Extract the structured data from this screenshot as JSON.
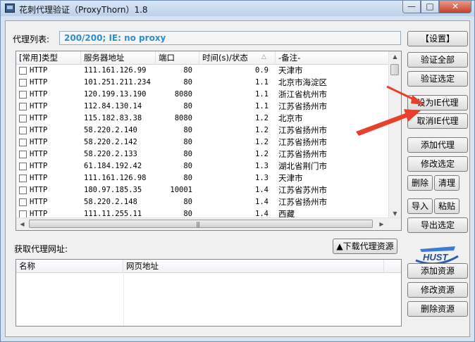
{
  "window": {
    "title": "花刺代理验证（ProxyThorn）1.8",
    "minimize": "—",
    "maximize": "□",
    "close": "✕"
  },
  "proxy_list": {
    "label": "代理列表:",
    "status": "200/200;   IE: no proxy",
    "columns": [
      "[常用]类型",
      "服务器地址",
      "端口",
      "时间(s)/状态",
      "-备注-"
    ],
    "rows": [
      {
        "type": "HTTP",
        "addr": "111.161.126.99",
        "port": "80",
        "time": "0.9",
        "note": "天津市"
      },
      {
        "type": "HTTP",
        "addr": "101.251.211.234",
        "port": "80",
        "time": "1.1",
        "note": "北京市海淀区"
      },
      {
        "type": "HTTP",
        "addr": "120.199.13.190",
        "port": "8080",
        "time": "1.1",
        "note": "浙江省杭州市"
      },
      {
        "type": "HTTP",
        "addr": "112.84.130.14",
        "port": "80",
        "time": "1.1",
        "note": "江苏省扬州市"
      },
      {
        "type": "HTTP",
        "addr": "115.182.83.38",
        "port": "8080",
        "time": "1.2",
        "note": "北京市"
      },
      {
        "type": "HTTP",
        "addr": "58.220.2.140",
        "port": "80",
        "time": "1.2",
        "note": "江苏省扬州市"
      },
      {
        "type": "HTTP",
        "addr": "58.220.2.142",
        "port": "80",
        "time": "1.2",
        "note": "江苏省扬州市"
      },
      {
        "type": "HTTP",
        "addr": "58.220.2.133",
        "port": "80",
        "time": "1.2",
        "note": "江苏省扬州市"
      },
      {
        "type": "HTTP",
        "addr": "61.184.192.42",
        "port": "80",
        "time": "1.3",
        "note": "湖北省荆门市"
      },
      {
        "type": "HTTP",
        "addr": "111.161.126.98",
        "port": "80",
        "time": "1.3",
        "note": "天津市"
      },
      {
        "type": "HTTP",
        "addr": "180.97.185.35",
        "port": "10001",
        "time": "1.4",
        "note": "江苏省苏州市"
      },
      {
        "type": "HTTP",
        "addr": "58.220.2.148",
        "port": "80",
        "time": "1.4",
        "note": "江苏省扬州市"
      },
      {
        "type": "HTTP",
        "addr": "111.11.255.11",
        "port": "80",
        "time": "1.4",
        "note": "西藏"
      }
    ]
  },
  "buttons": {
    "settings": "【设置】",
    "verify_all": "验证全部",
    "verify_selected": "验证选定",
    "set_ie_proxy": "设为IE代理",
    "cancel_ie_proxy": "取消IE代理",
    "add_proxy": "添加代理",
    "edit_selected": "修改选定",
    "delete": "删除",
    "clear": "清理",
    "import": "导入",
    "paste": "粘贴",
    "export_selected": "导出选定",
    "download_resources": "▲下载代理资源",
    "add_resource": "添加资源",
    "edit_resource": "修改资源",
    "delete_resource": "删除资源"
  },
  "fetch": {
    "label": "获取代理网址:",
    "columns": [
      "名称",
      "网页地址"
    ]
  },
  "logo_text": "HUST",
  "accent": {
    "status_text": "#2c8ecd",
    "arrow": "#e8402a",
    "close": "#c4412a"
  }
}
